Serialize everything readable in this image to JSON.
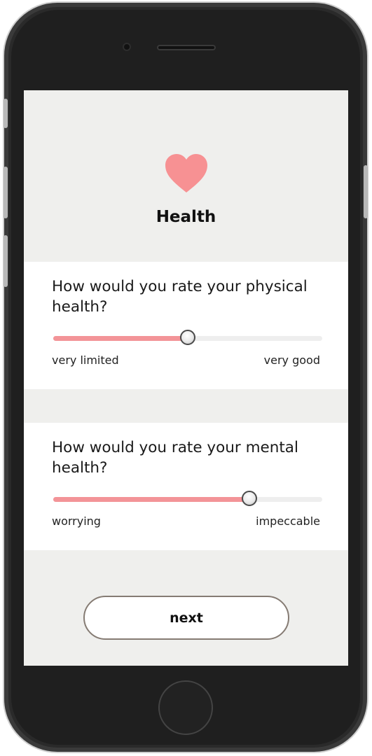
{
  "colors": {
    "accent": "#f39498",
    "screen_background": "#efefed",
    "card_background": "#ffffff",
    "button_border": "#857b73"
  },
  "header": {
    "icon": "heart-icon",
    "title": "Health"
  },
  "questions": [
    {
      "question": "How would you rate your physical health?",
      "label_min": "very limited",
      "label_max": "very good",
      "value_fraction": 0.5
    },
    {
      "question": "How would you rate your mental health?",
      "label_min": "worrying",
      "label_max": "impeccable",
      "value_fraction": 0.73
    }
  ],
  "footer": {
    "next_label": "next"
  }
}
